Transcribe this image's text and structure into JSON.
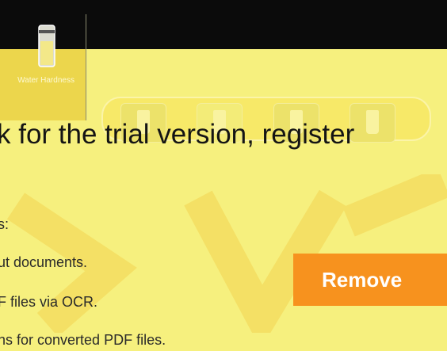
{
  "sidebar": {
    "label": "Water Hardness",
    "icon": "water-glass-icon"
  },
  "banner": {
    "headline": "k for the trial version, register",
    "lines": [
      "s:",
      "ut documents.",
      "F files via OCR.",
      "ns for converted PDF files."
    ],
    "remove_label": "Remove"
  },
  "colors": {
    "accent": "#f7921e",
    "overlay": "#f6f07e",
    "topbar": "#0b0b0b"
  }
}
